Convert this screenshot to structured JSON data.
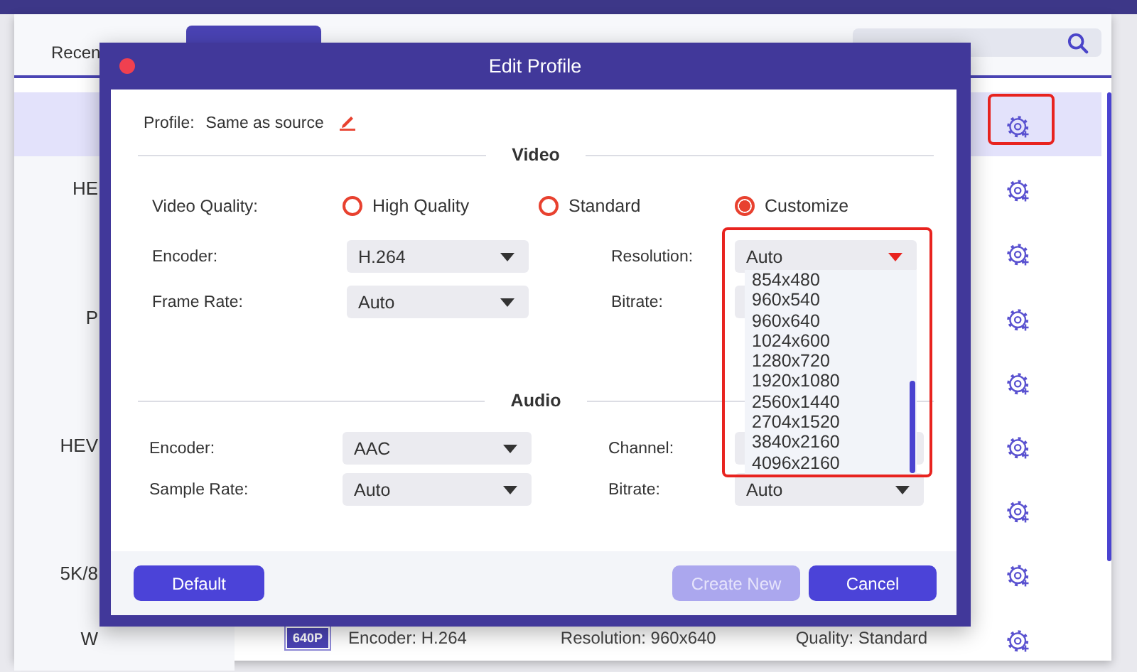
{
  "app": {
    "tabs": [
      {
        "label": "Recen",
        "selected": false
      },
      {
        "selected": true
      }
    ],
    "rows": [
      {
        "selected": true
      },
      {
        "name": "HE",
        "selected": false
      },
      {
        "selected": false
      },
      {
        "name": "P",
        "selected": false
      },
      {
        "selected": false
      },
      {
        "name": "HEV",
        "selected": false
      },
      {
        "selected": false
      },
      {
        "name": "5K/8",
        "selected": false
      },
      {
        "name": "W",
        "selected": false,
        "badge": "640P",
        "encoder": "Encoder: H.264",
        "resolution": "Resolution: 960x640",
        "quality": "Quality: Standard"
      }
    ]
  },
  "dialog": {
    "title": "Edit Profile",
    "profile_label": "Profile:",
    "profile_value": "Same as source",
    "video": {
      "heading": "Video",
      "quality_label": "Video Quality:",
      "quality_options": [
        {
          "label": "High Quality",
          "selected": false
        },
        {
          "label": "Standard",
          "selected": false
        },
        {
          "label": "Customize",
          "selected": true
        }
      ],
      "rows": [
        [
          {
            "label": "Encoder:",
            "value": "H.264",
            "open": false
          },
          {
            "label": "Resolution:",
            "value": "Auto",
            "open": true
          }
        ],
        [
          {
            "label": "Frame Rate:",
            "value": "Auto",
            "open": false
          },
          {
            "label": "Bitrate:"
          }
        ]
      ]
    },
    "resolution_options": [
      "854x480",
      "960x540",
      "960x640",
      "1024x600",
      "1280x720",
      "1920x1080",
      "2560x1440",
      "2704x1520",
      "3840x2160",
      "4096x2160"
    ],
    "audio": {
      "heading": "Audio",
      "rows": [
        [
          {
            "label": "Encoder:",
            "value": "AAC",
            "open": false
          },
          {
            "label": "Channel:"
          }
        ],
        [
          {
            "label": "Sample Rate:",
            "value": "Auto",
            "open": false
          },
          {
            "label": "Bitrate:",
            "value": "Auto",
            "open": false
          }
        ]
      ]
    },
    "buttons": [
      {
        "label": "Default",
        "disabled": false
      },
      {
        "label": "Create New",
        "disabled": true
      },
      {
        "label": "Cancel",
        "disabled": false
      }
    ]
  }
}
